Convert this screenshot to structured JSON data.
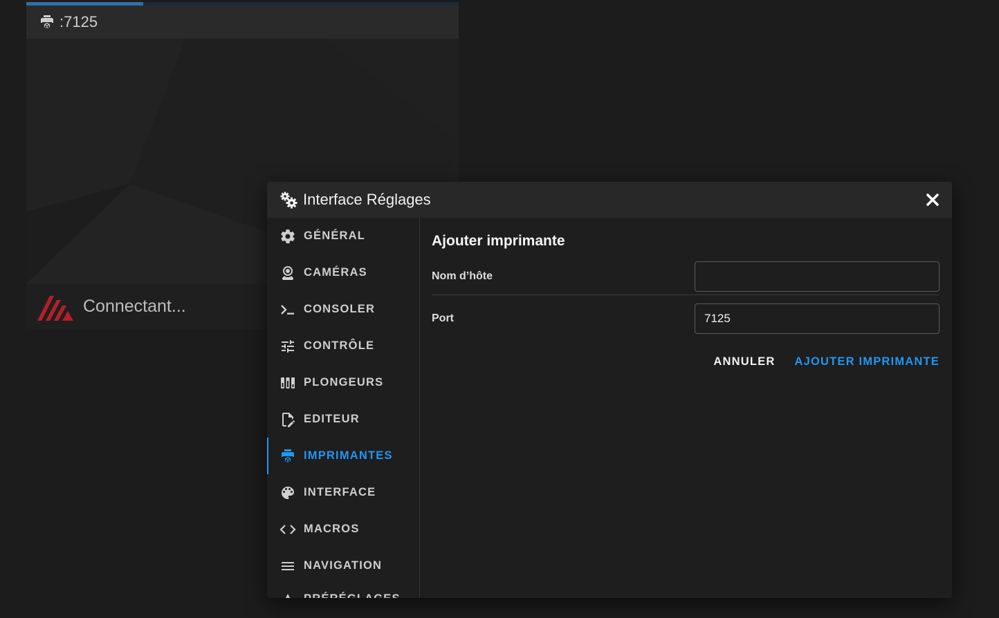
{
  "background_card": {
    "title": ":7125",
    "progress": 0.27,
    "status": "Connectant..."
  },
  "dialog": {
    "title": "Interface Réglages",
    "nav": [
      {
        "label": "GÉNÉRAL",
        "icon": "gear-icon",
        "active": false
      },
      {
        "label": "CAMÉRAS",
        "icon": "webcam-icon",
        "active": false
      },
      {
        "label": "CONSOLER",
        "icon": "console-icon",
        "active": false
      },
      {
        "label": "CONTRÔLE",
        "icon": "tune-icon",
        "active": false
      },
      {
        "label": "PLONGEURS",
        "icon": "plungers-icon",
        "active": false
      },
      {
        "label": "EDITEUR",
        "icon": "file-edit-icon",
        "active": false
      },
      {
        "label": "IMPRIMANTES",
        "icon": "printer-3d-icon",
        "active": true
      },
      {
        "label": "INTERFACE",
        "icon": "palette-icon",
        "active": false
      },
      {
        "label": "MACROS",
        "icon": "code-icon",
        "active": false
      },
      {
        "label": "NAVIGATION",
        "icon": "menu-icon",
        "active": false
      },
      {
        "label": "PRÉRÉGLAGES",
        "icon": "presets-icon",
        "active": false
      }
    ],
    "form": {
      "title": "Ajouter imprimante",
      "hostname_label": "Nom d’hôte",
      "hostname_value": "",
      "port_label": "Port",
      "port_value": "7125",
      "cancel_label": "ANNULER",
      "submit_label": "AJOUTER IMPRIMANTE"
    }
  },
  "colors": {
    "accent": "#2196f3",
    "background": "#1c1c1c",
    "dialog": "#1e1e1e",
    "logo_red": "#b3202a"
  }
}
